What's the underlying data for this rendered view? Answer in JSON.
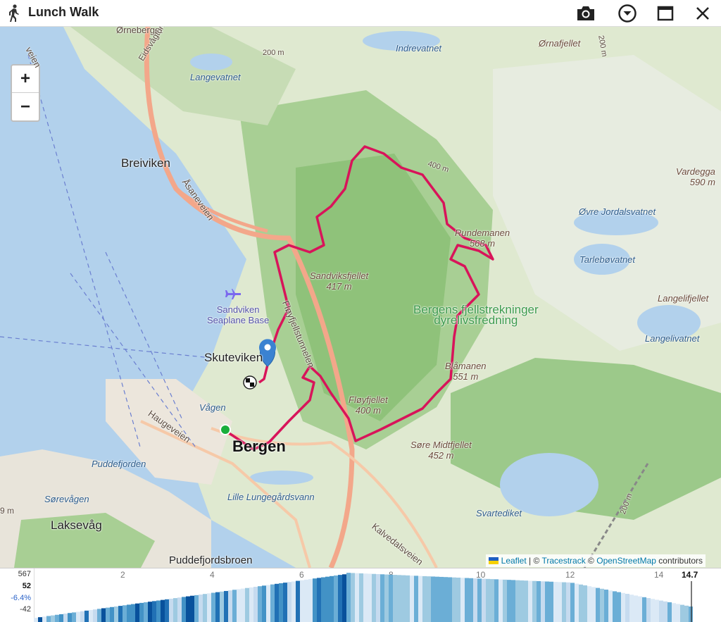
{
  "window": {
    "title": "Lunch Walk",
    "icons": [
      "walker-icon",
      "camera-icon",
      "chevron-down-circle-icon",
      "maximize-icon",
      "close-icon"
    ]
  },
  "map": {
    "zoom_in": "+",
    "zoom_out": "−",
    "labels": {
      "ornebergat": "Ørneberget",
      "eidsvagtunnelen": "Eidsvågtunnelen",
      "veien": "veien",
      "indrevatnet": "Indrevatnet",
      "ornafjellet": "Ørnafjellet",
      "langevatnet": "Langevatnet",
      "m200a": "200 m",
      "m400": "400 m",
      "m200b": "200 m",
      "breiviken": "Breiviken",
      "asaneveien": "Åsaneveien",
      "vardegga": "Vardegga",
      "vardegga_h": "590 m",
      "ovre_jordal": "Øvre Jordalsvatnet",
      "rundemanen": "Rundemanen",
      "rundemanen_h": "568 m",
      "tarlebo": "Tarlebøvatnet",
      "sandviksfjellet": "Sandviksfjellet",
      "sandviksfjellet_h": "417 m",
      "langelifjellet": "Langelifjellet",
      "sandviken": "Sandviken",
      "seaplane": "Seaplane Base",
      "floyfjell_tunnel": "Fløyfjellstunnelen",
      "prot1": "Bergens fjellstrekninger",
      "prot2": "dyrelivsfredning",
      "langelivatnet": "Langelivatnet",
      "skuteviken": "Skuteviken",
      "blamanen": "Blåmanen",
      "blamanen_h": "551 m",
      "vagen": "Vågen",
      "haugeveien": "Haugeveien",
      "floyfjellet": "Fløyfjellet",
      "floyfjellet_h": "400 m",
      "bergen": "Bergen",
      "sore_midt": "Søre Midtfjellet",
      "sore_midt_h": "452 m",
      "puddefjorden": "Puddefjorden",
      "sorevagen": "Sørevågen",
      "lille_lung": "Lille Lungegårdsvann",
      "svartediket": "Svartediket",
      "m9": "9 m",
      "laksevag": "Laksevåg",
      "kalvedalsveien": "Kalvedalsveien",
      "puddefjordsbroen": "Puddefjordsbroen",
      "m200c": "200 m"
    },
    "attribution": {
      "leaflet": "Leaflet",
      "sep1": "|",
      "copy1": "©",
      "tracestrack": "Tracestrack",
      "copy2": "©",
      "osm": "OpenStreetMap",
      "contrib": "contributors"
    }
  },
  "elevation": {
    "y_labels": {
      "max": "567",
      "current": "52",
      "grade": "-6.4%",
      "min": "-42"
    },
    "x_ticks": [
      "2",
      "4",
      "6",
      "8",
      "10",
      "12",
      "14"
    ],
    "x_end": "14.7",
    "colors": {
      "track": "#d8145a",
      "grade_light": "#dbe9f6",
      "grade_dark": "#08519c"
    }
  }
}
